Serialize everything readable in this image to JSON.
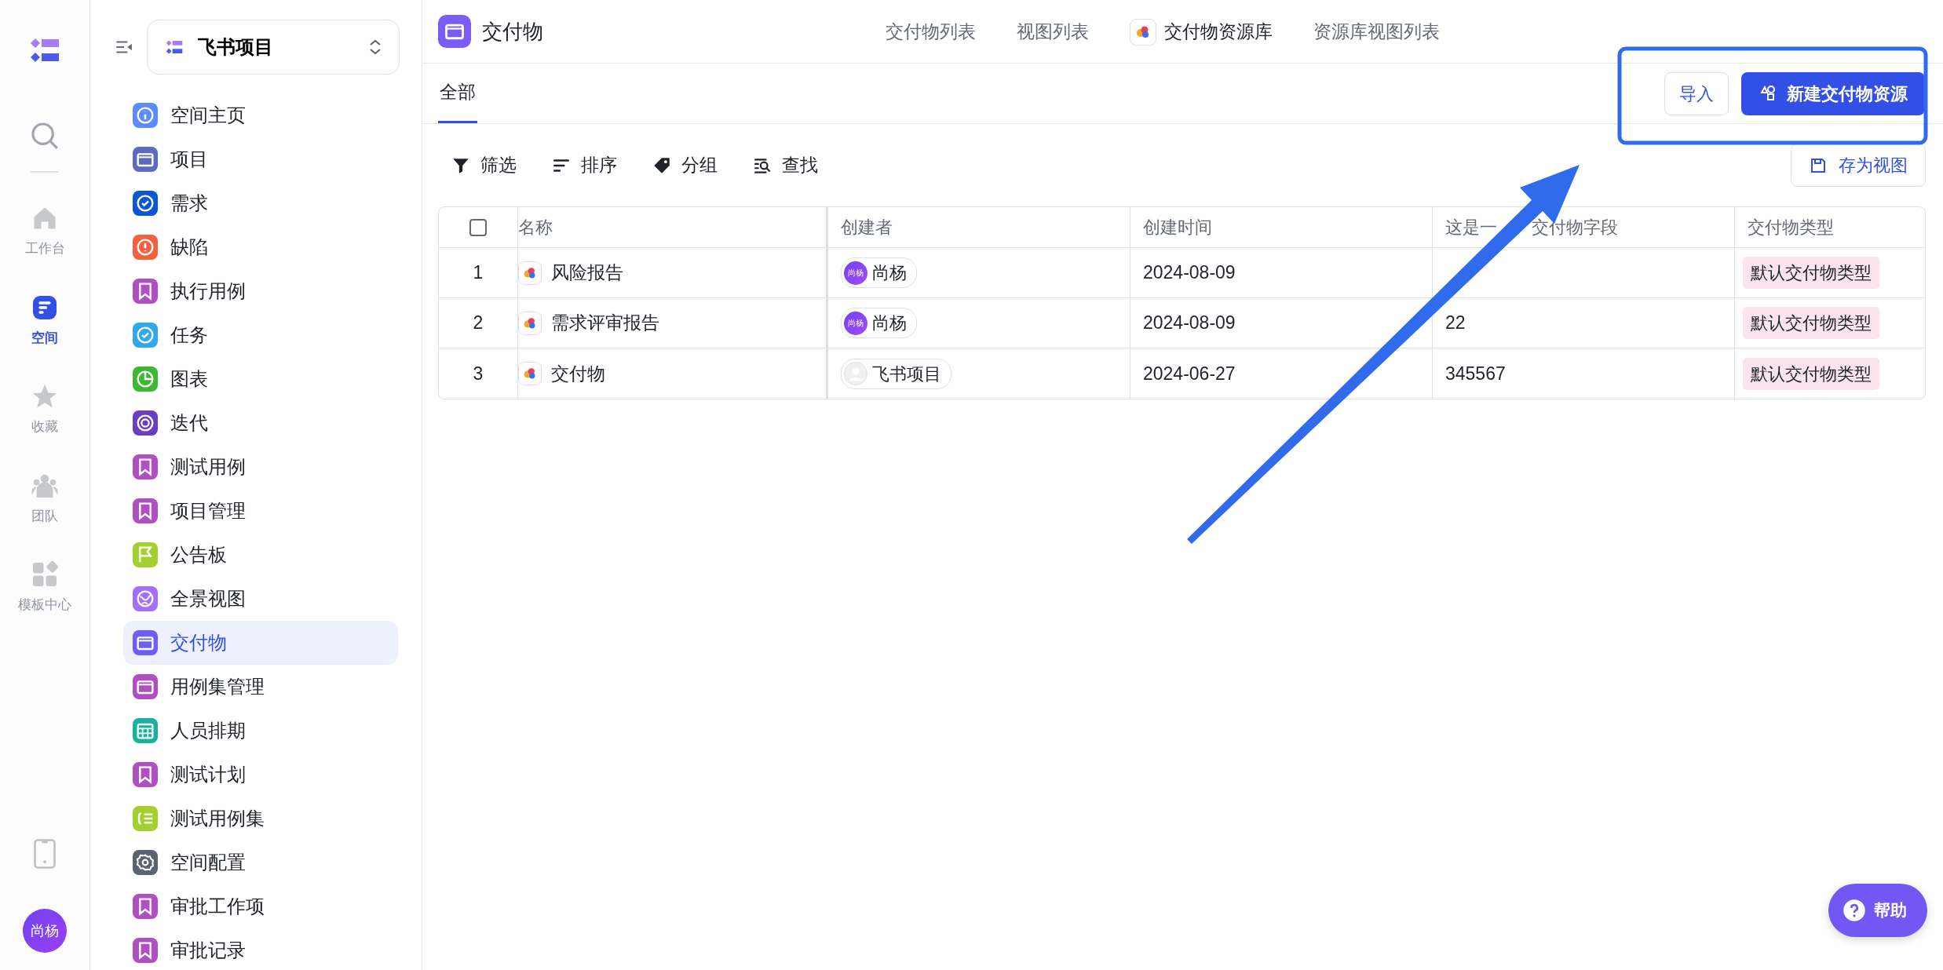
{
  "rail": {
    "items": [
      {
        "kind": "home",
        "label": "工作台",
        "selected": false
      },
      {
        "kind": "space",
        "label": "空间",
        "selected": true
      },
      {
        "kind": "star",
        "label": "收藏",
        "selected": false
      },
      {
        "kind": "team",
        "label": "团队",
        "selected": false
      },
      {
        "kind": "template",
        "label": "模板中心",
        "selected": false
      }
    ],
    "avatar": "尚杨"
  },
  "space_switcher": {
    "name": "飞书项目"
  },
  "nav": [
    {
      "kind": "info",
      "label": "空间主页",
      "color": "#5a8cfb",
      "selected": false
    },
    {
      "kind": "folder",
      "label": "项目",
      "color": "#5c6bc0",
      "selected": false
    },
    {
      "kind": "check",
      "label": "需求",
      "color": "#0a57d6",
      "selected": false
    },
    {
      "kind": "alert",
      "label": "缺陷",
      "color": "#f5613f",
      "selected": false
    },
    {
      "kind": "bookmark",
      "label": "执行用例",
      "color": "#b04fc4",
      "selected": false
    },
    {
      "kind": "check",
      "label": "任务",
      "color": "#2fa9ee",
      "selected": false
    },
    {
      "kind": "pie",
      "label": "图表",
      "color": "#3bb932",
      "selected": false
    },
    {
      "kind": "cycle",
      "label": "迭代",
      "color": "#6a3ec2",
      "selected": false
    },
    {
      "kind": "bookmark",
      "label": "测试用例",
      "color": "#b04fc4",
      "selected": false
    },
    {
      "kind": "bookmark",
      "label": "项目管理",
      "color": "#b04fc4",
      "selected": false
    },
    {
      "kind": "flag",
      "label": "公告板",
      "color": "#a2d12e",
      "selected": false
    },
    {
      "kind": "globe",
      "label": "全景视图",
      "color": "#a46ef8",
      "selected": false
    },
    {
      "kind": "folder",
      "label": "交付物",
      "color": "#6b5ef7",
      "selected": true
    },
    {
      "kind": "folder",
      "label": "用例集管理",
      "color": "#b04fc4",
      "selected": false
    },
    {
      "kind": "calendar",
      "label": "人员排期",
      "color": "#14b39b",
      "selected": false
    },
    {
      "kind": "bookmark",
      "label": "测试计划",
      "color": "#b04fc4",
      "selected": false
    },
    {
      "kind": "list",
      "label": "测试用例集",
      "color": "#a2d12e",
      "selected": false
    },
    {
      "kind": "gear",
      "label": "空间配置",
      "color": "#5c6370",
      "selected": false
    },
    {
      "kind": "bookmark",
      "label": "审批工作项",
      "color": "#b04fc4",
      "selected": false
    },
    {
      "kind": "bookmark",
      "label": "审批记录",
      "color": "#b04fc4",
      "selected": false
    }
  ],
  "header": {
    "title": "交付物",
    "tabs": [
      {
        "label": "交付物列表",
        "has_icon": false,
        "selected": false
      },
      {
        "label": "视图列表",
        "has_icon": false,
        "selected": false
      },
      {
        "label": "交付物资源库",
        "has_icon": true,
        "selected": true
      },
      {
        "label": "资源库视图列表",
        "has_icon": false,
        "selected": false
      }
    ]
  },
  "view_tabs": [
    {
      "label": "全部",
      "selected": true
    }
  ],
  "actions": {
    "import": "导入",
    "create": "新建交付物资源"
  },
  "toolbar": [
    {
      "kind": "filter",
      "label": "筛选"
    },
    {
      "kind": "sort",
      "label": "排序"
    },
    {
      "kind": "group",
      "label": "分组"
    },
    {
      "kind": "find",
      "label": "查找"
    }
  ],
  "save_view": "存为视图",
  "table": {
    "select_all": {
      "checked": false
    },
    "columns": [
      {
        "parts": [
          "名称"
        ]
      },
      {
        "parts": [
          "创建者"
        ]
      },
      {
        "parts": [
          "创建时间"
        ]
      },
      {
        "parts": [
          "这是一",
          "交付物字段"
        ]
      },
      {
        "parts": [
          "交付物类型"
        ]
      }
    ],
    "rows": [
      {
        "index": "1",
        "name": "风险报告",
        "creator": {
          "kind": "user",
          "avatar": "尚杨",
          "name": "尚杨"
        },
        "created": "2024-08-09",
        "type": "默认交付物类型"
      },
      {
        "index": "2",
        "name": "需求评审报告",
        "creator": {
          "kind": "user",
          "avatar": "尚杨",
          "name": "尚杨"
        },
        "created": "2024-08-09",
        "field": "22",
        "type": "默认交付物类型"
      },
      {
        "index": "3",
        "name": "交付物",
        "creator": {
          "kind": "bot",
          "name": "飞书项目"
        },
        "created": "2024-06-27",
        "field": "345567",
        "type": "默认交付物类型"
      }
    ]
  },
  "help": {
    "label": "帮助"
  }
}
